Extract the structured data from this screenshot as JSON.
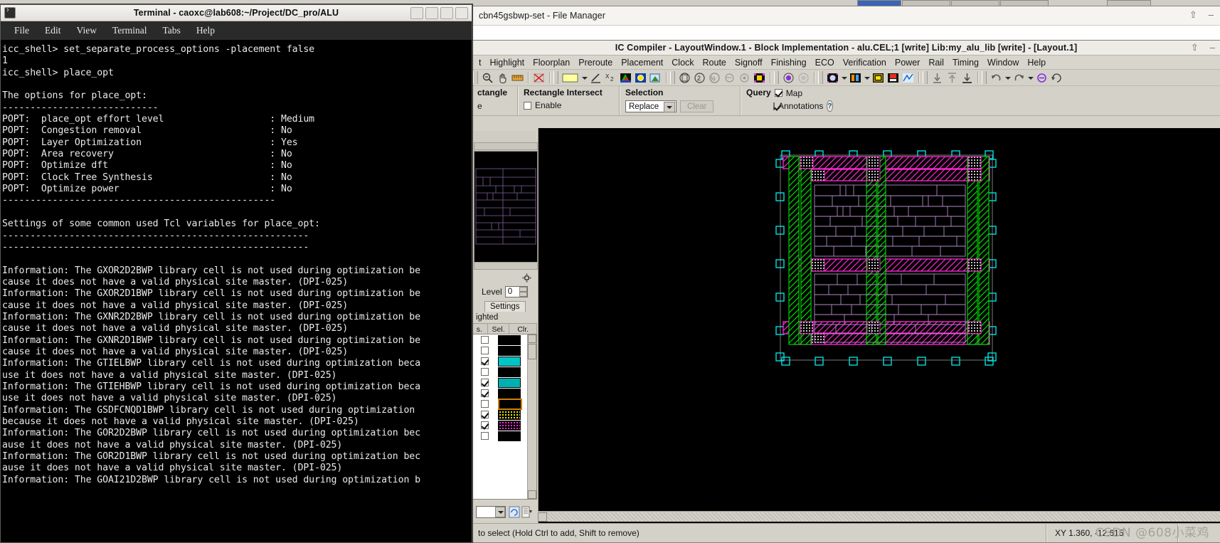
{
  "desktop": {
    "taskbar_buttons": [
      "",
      "",
      "",
      "",
      ""
    ]
  },
  "file_manager": {
    "title": "cbn45gsbwp-set - File Manager",
    "window_buttons": [
      "shade",
      "minimize"
    ]
  },
  "terminal": {
    "title": "Terminal - caoxc@lab608:~/Project/DC_pro/ALU",
    "icon": "terminal-icon",
    "menus": [
      "File",
      "Edit",
      "View",
      "Terminal",
      "Tabs",
      "Help"
    ],
    "window_buttons": [
      "shade",
      "minimize",
      "maximize",
      "close"
    ],
    "content": "icc_shell> set_separate_process_options -placement false\n1\nicc_shell> place_opt\n\nThe options for place_opt:\n----------------------------\nPOPT:  place_opt effort level                   : Medium\nPOPT:  Congestion removal                       : No\nPOPT:  Layer Optimization                       : Yes\nPOPT:  Area recovery                            : No\nPOPT:  Optimize dft                             : No\nPOPT:  Clock Tree Synthesis                     : No\nPOPT:  Optimize power                           : No\n-------------------------------------------------\n\nSettings of some common used Tcl variables for place_opt:\n-------------------------------------------------------\n-------------------------------------------------------\n\nInformation: The GXOR2D2BWP library cell is not used during optimization be\ncause it does not have a valid physical site master. (DPI-025)\nInformation: The GXOR2D1BWP library cell is not used during optimization be\ncause it does not have a valid physical site master. (DPI-025)\nInformation: The GXNR2D2BWP library cell is not used during optimization be\ncause it does not have a valid physical site master. (DPI-025)\nInformation: The GXNR2D1BWP library cell is not used during optimization be\ncause it does not have a valid physical site master. (DPI-025)\nInformation: The GTIELBWP library cell is not used during optimization beca\nuse it does not have a valid physical site master. (DPI-025)\nInformation: The GTIEHBWP library cell is not used during optimization beca\nuse it does not have a valid physical site master. (DPI-025)\nInformation: The GSDFCNQD1BWP library cell is not used during optimization\nbecause it does not have a valid physical site master. (DPI-025)\nInformation: The GOR2D2BWP library cell is not used during optimization bec\nause it does not have a valid physical site master. (DPI-025)\nInformation: The GOR2D1BWP library cell is not used during optimization bec\nause it does not have a valid physical site master. (DPI-025)\nInformation: The GOAI21D2BWP library cell is not used during optimization b"
  },
  "icc": {
    "title": "IC Compiler - LayoutWindow.1 - Block Implementation - alu.CEL;1 [write]   Lib:my_alu_lib [write] - [Layout.1]",
    "window_buttons": [
      "shade",
      "minimize"
    ],
    "menus": [
      {
        "label": "t",
        "accel": ""
      },
      {
        "label": "Highlight",
        "accel": "H"
      },
      {
        "label": "Floorplan",
        "accel": "l"
      },
      {
        "label": "Preroute",
        "accel": "o"
      },
      {
        "label": "Placement",
        "accel": "P"
      },
      {
        "label": "Clock",
        "accel": "C"
      },
      {
        "label": "Route",
        "accel": "R"
      },
      {
        "label": "Signoff",
        "accel": "f"
      },
      {
        "label": "Finishing",
        "accel": "i"
      },
      {
        "label": "ECO",
        "accel": "C"
      },
      {
        "label": "Verification",
        "accel": "i"
      },
      {
        "label": "Power",
        "accel": "o"
      },
      {
        "label": "Rail",
        "accel": "a"
      },
      {
        "label": "Timing",
        "accel": "T"
      },
      {
        "label": "Window",
        "accel": "W"
      },
      {
        "label": "Help",
        "accel": "H"
      }
    ],
    "options_bar": {
      "group_rectangle": {
        "head": "ctangle",
        "sub": "e"
      },
      "group_intersect": {
        "head": "Rectangle Intersect",
        "enable_label": "Enable",
        "enable_checked": false
      },
      "group_selection": {
        "head": "Selection",
        "mode_value": "Replace",
        "clear_label": "Clear",
        "clear_enabled": false
      },
      "group_query": {
        "head": "Query",
        "map_label": "Map",
        "map_checked": true,
        "annotations_label": "Annotations",
        "annotations_checked": true,
        "help_icon": "question-icon"
      }
    },
    "left_panel": {
      "gear_icon": "gear-icon",
      "level_label": "Level",
      "level_value": "0",
      "settings_tab": "Settings",
      "highlighted_label": "ighted",
      "columns": [
        "s.",
        "Sel.",
        "Clr."
      ],
      "rows": [
        {
          "selected": false,
          "color": "#000000",
          "pattern": "solid"
        },
        {
          "selected": false,
          "color": "#000000",
          "pattern": "solid"
        },
        {
          "selected": true,
          "color": "#00c8c8",
          "pattern": "solid"
        },
        {
          "selected": false,
          "color": "#000000",
          "pattern": "solid"
        },
        {
          "selected": true,
          "color": "#00b4b4",
          "pattern": "solid"
        },
        {
          "selected": true,
          "color": "#000000",
          "pattern": "solid"
        },
        {
          "selected": false,
          "color": "#c8a000",
          "pattern": "outline"
        },
        {
          "selected": true,
          "color": "#dcdc00",
          "pattern": "dots"
        },
        {
          "selected": true,
          "color": "#ff00ff",
          "pattern": "dots"
        },
        {
          "selected": false,
          "color": "#000000",
          "pattern": "solid"
        }
      ]
    },
    "statusbar": {
      "message": "to select (Hold Ctrl to add, Shift to remove)",
      "xy": "XY 1.360, -12.615"
    },
    "watermark": "CSDN @608小菜鸡",
    "layout_colors": {
      "background": "#000000",
      "power_ring": "#ff2ad4",
      "vertical_strap": "#00e000",
      "std_cell_rows": "#b48ac8",
      "pin_marker": "#00e0e0",
      "boundary": "#808080"
    }
  }
}
